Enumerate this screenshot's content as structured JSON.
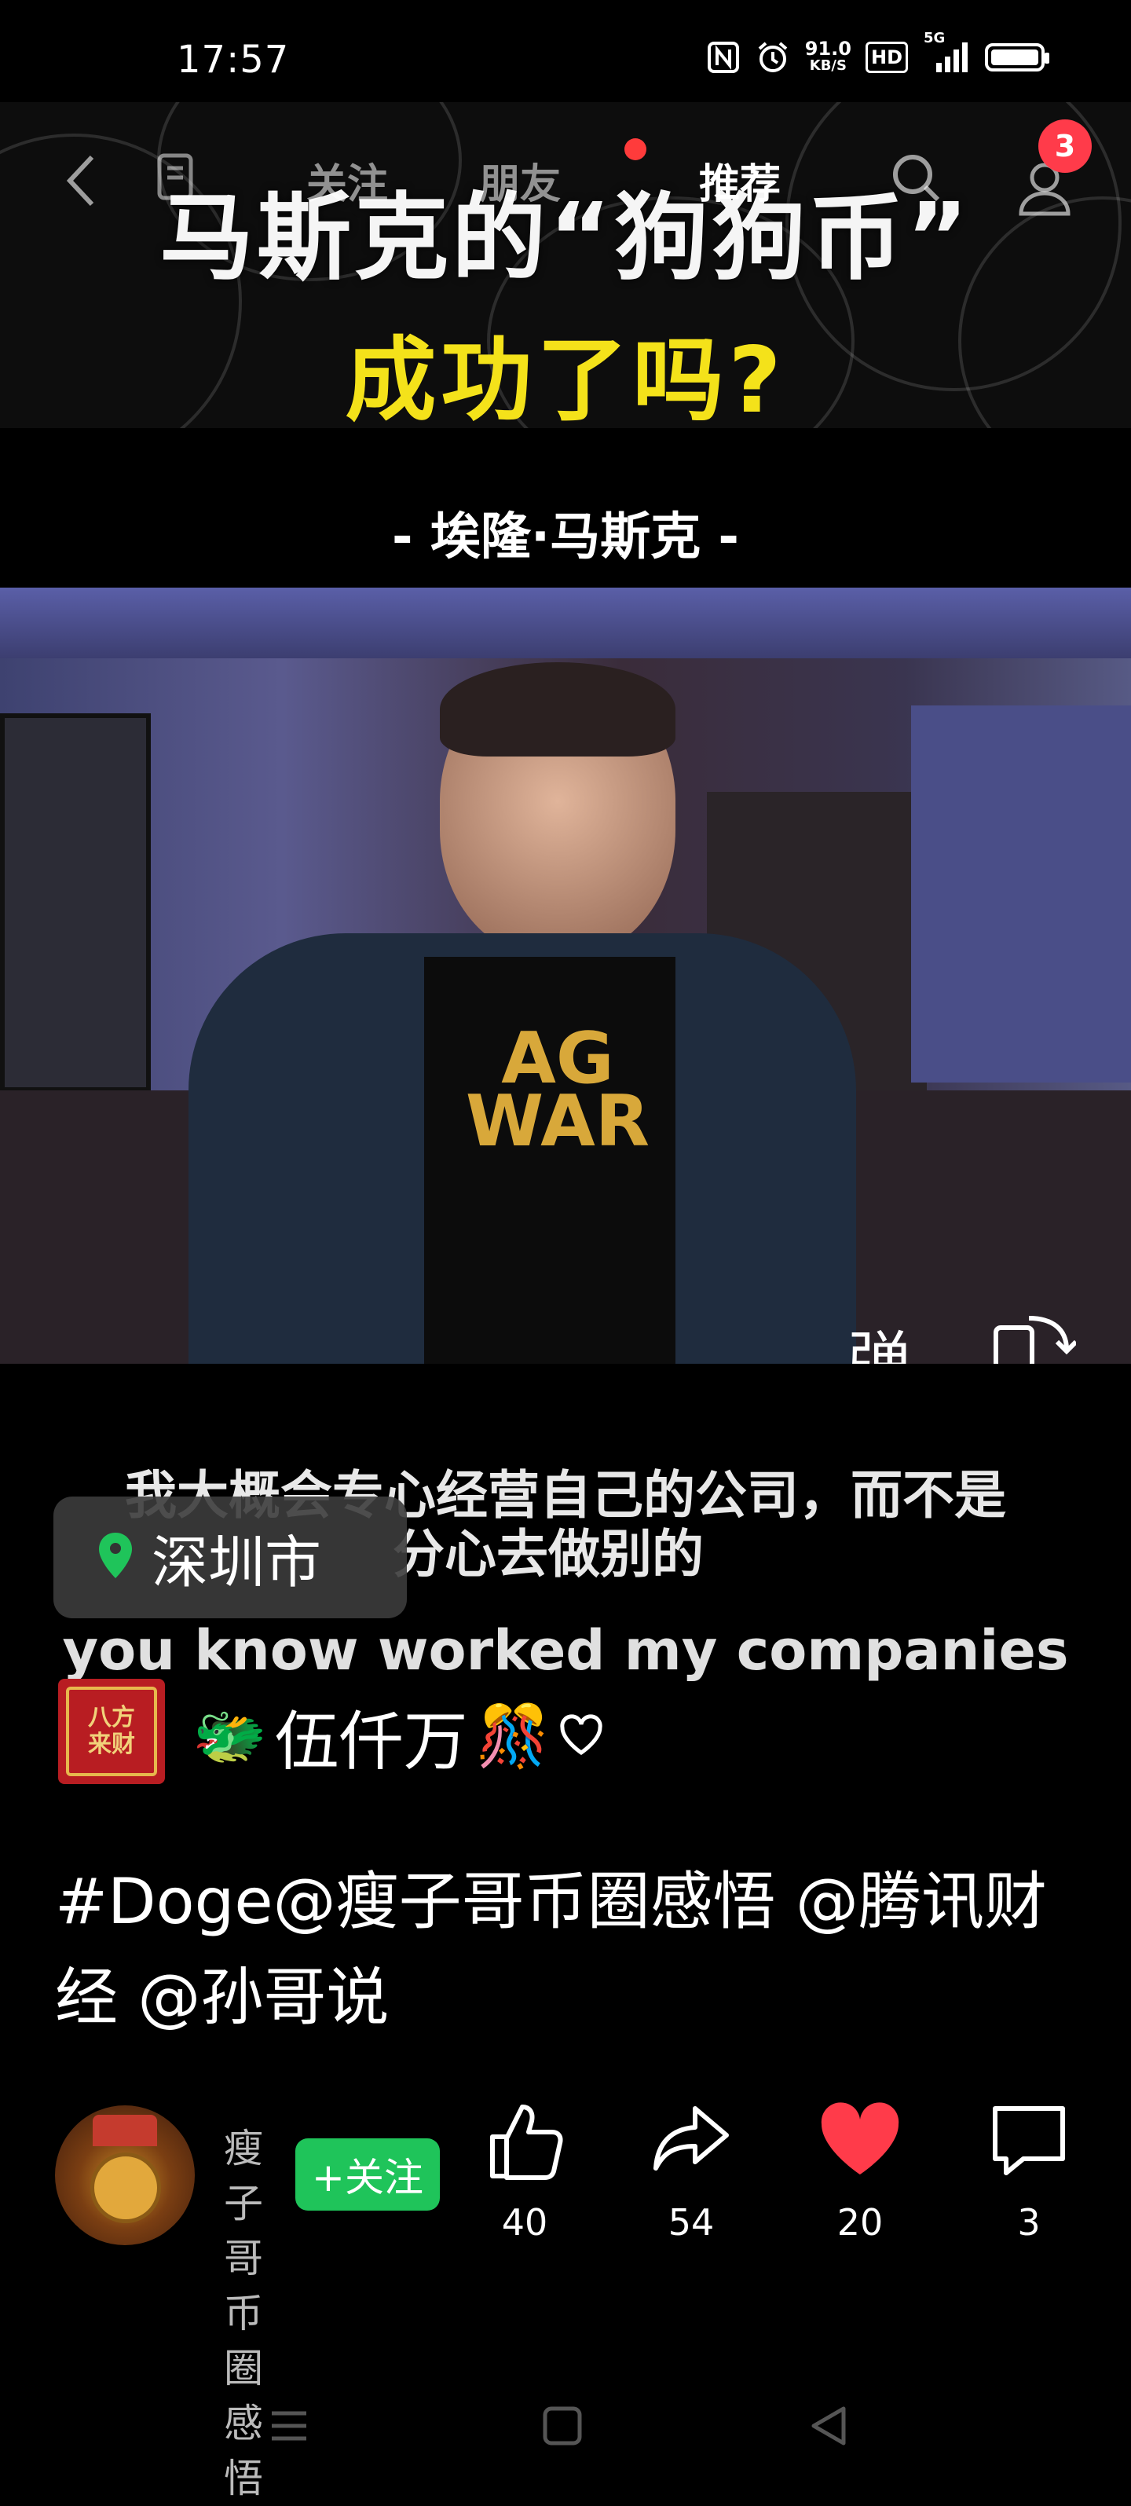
{
  "status_bar": {
    "time": "17:57",
    "net_speed_value": "91.0",
    "net_speed_unit": "KB/S",
    "hd_label": "HD",
    "signal_label": "5G",
    "battery_level": 1.0
  },
  "video": {
    "headline_line1": "马斯克的“狗狗币”",
    "headline_line2": "成功了吗?",
    "speaker": "- 埃隆·马斯克 -",
    "subtitle_cn_line1": "我大概会专心经营自己的公司，而不是",
    "subtitle_cn_line2": "分心去做别的",
    "subtitle_en": "you know worked my companies",
    "danmaku_label": "弹"
  },
  "top_nav": {
    "tabs": [
      {
        "label": "关注"
      },
      {
        "label": "朋友"
      },
      {
        "label": "推荐"
      }
    ],
    "notification_count": "3"
  },
  "location": {
    "text": "深圳市"
  },
  "music": {
    "cover_text": "八方来财",
    "name": "伍仟万"
  },
  "description": "#Doge@瘦子哥币圈感悟 @腾讯财经 @孙哥说",
  "author": {
    "name": "瘦子哥币圈感悟",
    "follow_label": "+关注"
  },
  "actions": {
    "like_count": "40",
    "share_count": "54",
    "favorite_count": "20",
    "comment_count": "3"
  },
  "colors": {
    "headline_accent": "#f4e21a",
    "follow_green": "#1fc45a",
    "favorite_red": "#ff3b4a",
    "badge_red": "#ff3b4a"
  }
}
